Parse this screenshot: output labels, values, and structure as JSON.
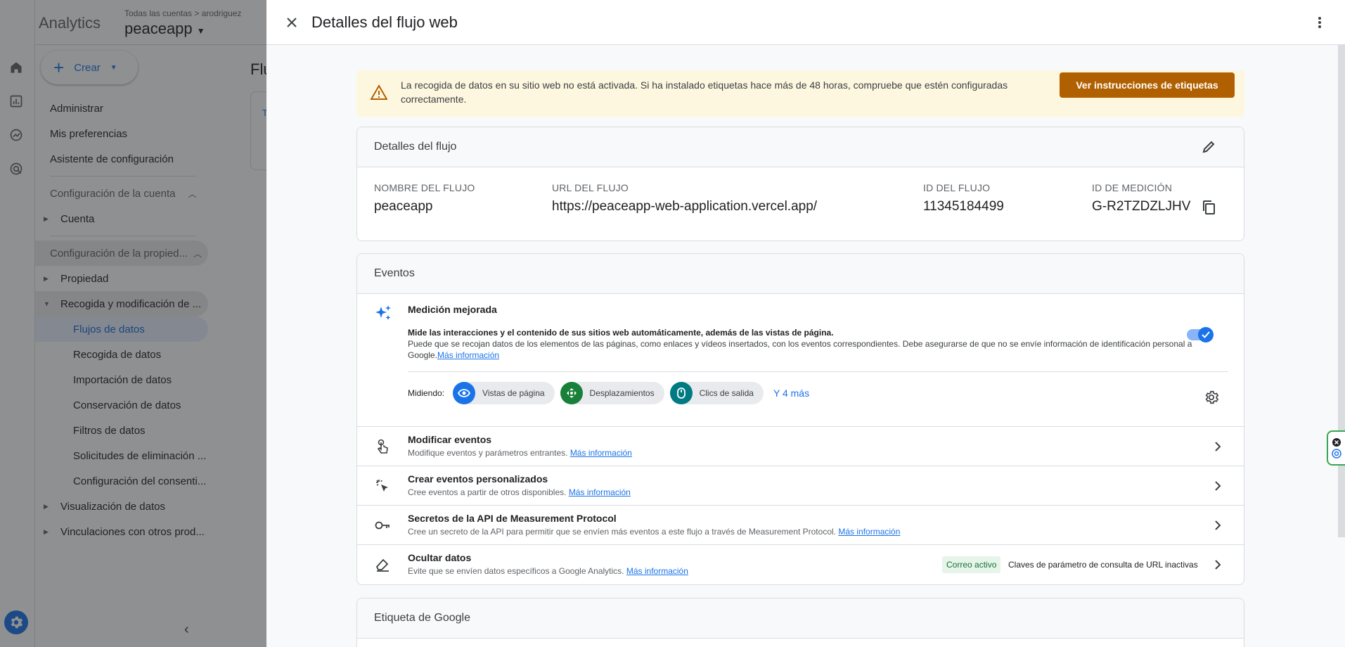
{
  "app": {
    "product_name": "Analytics",
    "account_crumb": "Todas las cuentas > arodriguez",
    "property_name": "peaceapp",
    "create_label": "Crear",
    "background_title": "Flu",
    "background_tab": "T",
    "nav": {
      "admin": "Administrar",
      "prefs": "Mis preferencias",
      "setup": "Asistente de configuración",
      "account_section": "Configuración de la cuenta",
      "account": "Cuenta",
      "property_section": "Configuración de la propied...",
      "property": "Propiedad",
      "collection": "Recogida y modificación de ...",
      "data_streams": "Flujos de datos",
      "data_collection": "Recogida de datos",
      "data_import": "Importación de datos",
      "data_retention": "Conservación de datos",
      "data_filters": "Filtros de datos",
      "deletion_requests": "Solicitudes de eliminación ...",
      "consent": "Configuración del consenti...",
      "data_display": "Visualización de datos",
      "product_links": "Vinculaciones con otros prod..."
    }
  },
  "drawer": {
    "title": "Detalles del flujo web",
    "banner": {
      "text": "La recogida de datos en su sitio web no está activada. Si ha instalado etiquetas hace más de 48 horas, compruebe que estén configuradas correctamente.",
      "button": "Ver instrucciones de etiquetas"
    },
    "stream": {
      "heading": "Detalles del flujo",
      "name_label": "NOMBRE DEL FLUJO",
      "name_value": "peaceapp",
      "url_label": "URL DEL FLUJO",
      "url_value": "https://peaceapp-web-application.vercel.app/",
      "id_label": "ID DEL FLUJO",
      "id_value": "11345184499",
      "mid_label": "ID DE MEDICIÓN",
      "mid_value": "G-R2TZDZLJHV"
    },
    "events": {
      "heading": "Eventos",
      "em_title": "Medición mejorada",
      "em_desc1": "Mide las interacciones y el contenido de sus sitios web automáticamente, además de las vistas de página.",
      "em_desc2": "Puede que se recojan datos de los elementos de las páginas, como enlaces y vídeos insertados, con los eventos correspondientes. Debe asegurarse de que no se envíe información de identificación personal a Google.",
      "learn_more": "Más información",
      "measuring_label": "Midiendo:",
      "chips": [
        "Vistas de página",
        "Desplazamientos",
        "Clics de salida"
      ],
      "more_chips": "Y 4 más",
      "enabled": true,
      "rows": [
        {
          "title": "Modificar eventos",
          "desc": "Modifique eventos y parámetros entrantes.",
          "link": "Más información"
        },
        {
          "title": "Crear eventos personalizados",
          "desc": "Cree eventos a partir de otros disponibles.",
          "link": "Más información"
        },
        {
          "title": "Secretos de la API de Measurement Protocol",
          "desc": "Cree un secreto de la API para permitir que se envíen más eventos a este flujo a través de Measurement Protocol.",
          "link": "Más información"
        },
        {
          "title": "Ocultar datos",
          "desc": "Evite que se envíen datos específicos a Google Analytics.",
          "link": "Más información"
        }
      ],
      "badge_active": "Correo activo",
      "badge_inactive": "Claves de parámetro de consulta de URL inactivas"
    },
    "tag": {
      "heading": "Etiqueta de Google"
    }
  },
  "colors": {
    "accent": "#1a73e8",
    "warning_bg": "#fef7e0",
    "warning_button": "#b06000",
    "chip_blue": "#1a73e8",
    "chip_green": "#188038",
    "chip_teal": "#007b83"
  }
}
